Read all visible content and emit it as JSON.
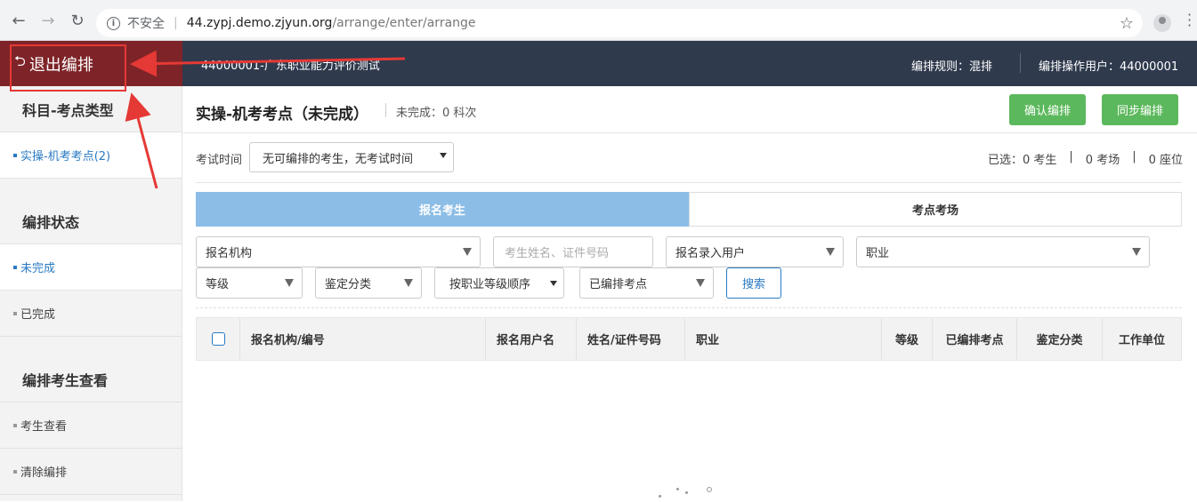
{
  "browser": {
    "back_icon": "←",
    "forward_icon": "→",
    "reload_icon": "↻",
    "security_label": "不安全",
    "url_host": "44.zypj.demo.zjyun.org",
    "url_path": "/arrange/enter/arrange",
    "bookmark_icon": "☆"
  },
  "header": {
    "exit_label": "退出编排",
    "exit_icon": "⮌",
    "exam_title": "44000001-广东职业能力评价测试",
    "rule_label": "编排规则：混排",
    "user_label": "编排操作用户：44000001",
    "header_bg": "#2f3a4d",
    "exit_bg": "#7e2428"
  },
  "sidebar": {
    "subject_heading": "科目-考点类型",
    "subject_items": [
      {
        "label": "实操-机考考点(2)",
        "active": true
      }
    ],
    "status_heading": "编排状态",
    "status_items": [
      {
        "label": "未完成",
        "active": true
      },
      {
        "label": "已完成",
        "active": false
      }
    ],
    "view_heading": "编排考生查看",
    "view_items": [
      {
        "label": "考生查看"
      },
      {
        "label": "清除编排"
      }
    ]
  },
  "main": {
    "title": "实操-机考考点（未完成）",
    "progress": "未完成：0 科次",
    "confirm_button": "确认编排",
    "sync_button": "同步编排",
    "exam_time_label": "考试时间",
    "exam_time_value": "无可编排的考生，无考试时间",
    "selected_students": "已选：0 考生",
    "stat_sep": "|",
    "selected_rooms": "0 考场",
    "selected_seats": "0 座位",
    "tabs": [
      {
        "label": "报名考生",
        "active": true
      },
      {
        "label": "考点考场",
        "active": false
      }
    ],
    "filters": {
      "org": "报名机构",
      "name_placeholder": "考生姓名、证件号码",
      "entry_user": "报名录入用户",
      "occupation": "职业",
      "level": "等级",
      "category": "鉴定分类",
      "order": "按职业等级顺序",
      "arranged": "已编排考点",
      "search": "搜索"
    },
    "table_headers": [
      "报名机构/编号",
      "报名用户名",
      "姓名/证件号码",
      "职业",
      "等级",
      "已编排考点",
      "鉴定分类",
      "工作单位"
    ],
    "accent": "#2a7ac4",
    "green": "#5cb85c",
    "tab_active_bg": "#8bbde6"
  }
}
